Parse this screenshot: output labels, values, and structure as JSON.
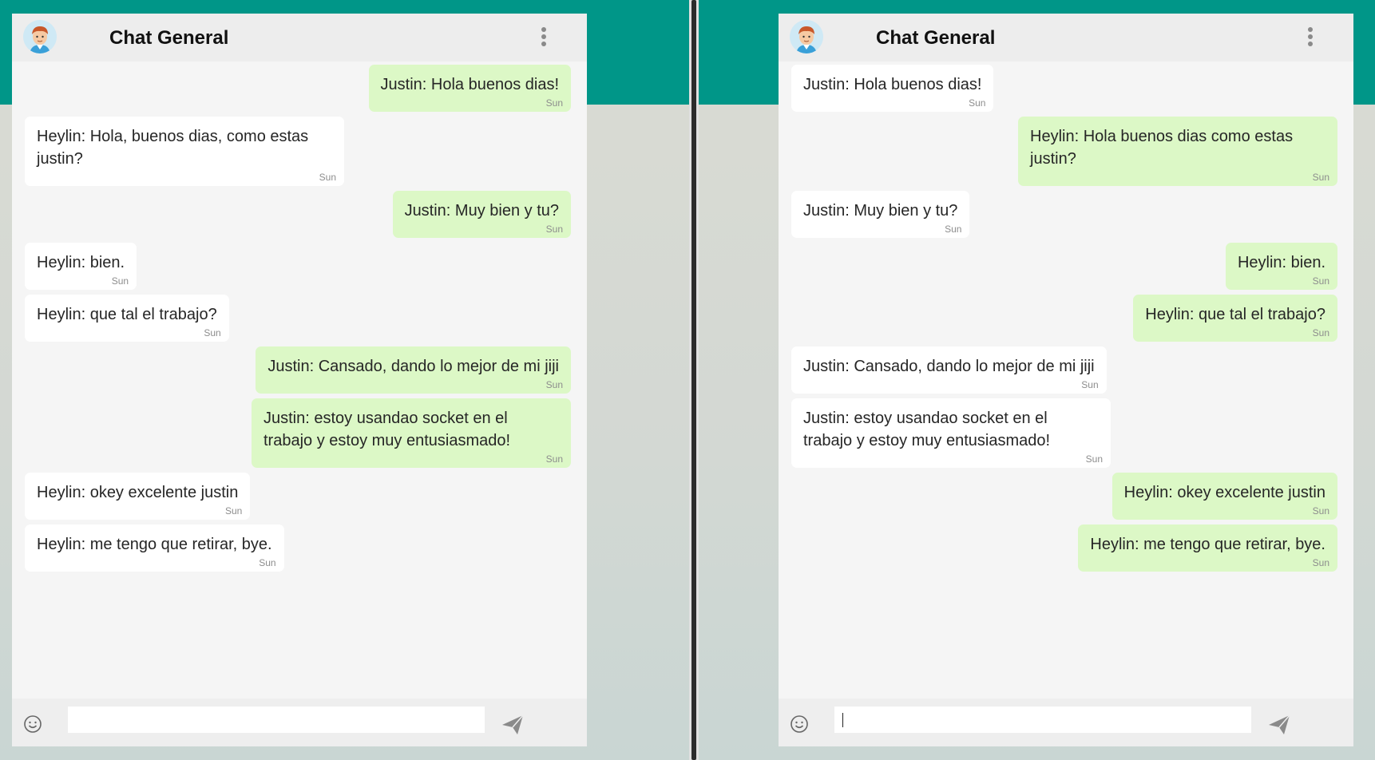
{
  "colors": {
    "teal": "#009688",
    "outgoing_bubble": "#dcf8c6",
    "incoming_bubble": "#ffffff",
    "chat_bg": "#f5f5f5"
  },
  "panels": [
    {
      "header": {
        "title": "Chat General",
        "avatar_icon": "user-avatar",
        "menu_icon": "more-vertical-icon"
      },
      "messages": [
        {
          "dir": "out",
          "text": "Justin: Hola buenos dias!",
          "time": "Sun"
        },
        {
          "dir": "in",
          "text": "Heylin: Hola, buenos dias, como estas justin?",
          "time": "Sun"
        },
        {
          "dir": "out",
          "text": "Justin: Muy bien y tu?",
          "time": "Sun"
        },
        {
          "dir": "in",
          "text": "Heylin: bien.",
          "time": "Sun"
        },
        {
          "dir": "in",
          "text": "Heylin: que tal el trabajo?",
          "time": "Sun"
        },
        {
          "dir": "out",
          "text": "Justin: Cansado, dando lo mejor de mi jiji",
          "time": "Sun"
        },
        {
          "dir": "out",
          "text": "Justin: estoy usandao socket en el trabajo y estoy muy entusiasmado!",
          "time": "Sun"
        },
        {
          "dir": "in",
          "text": "Heylin: okey excelente justin",
          "time": "Sun"
        },
        {
          "dir": "in",
          "text": "Heylin: me tengo que retirar, bye.",
          "time": "Sun"
        }
      ],
      "composer": {
        "value": "",
        "placeholder": "",
        "emoji_icon": "smiley-icon",
        "send_icon": "send-icon"
      }
    },
    {
      "header": {
        "title": "Chat General",
        "avatar_icon": "user-avatar",
        "menu_icon": "more-vertical-icon"
      },
      "messages": [
        {
          "dir": "in",
          "text": "Justin: Hola buenos dias!",
          "time": "Sun"
        },
        {
          "dir": "out",
          "text": "Heylin: Hola buenos dias como estas justin?",
          "time": "Sun"
        },
        {
          "dir": "in",
          "text": "Justin: Muy bien y tu?",
          "time": "Sun"
        },
        {
          "dir": "out",
          "text": "Heylin: bien.",
          "time": "Sun"
        },
        {
          "dir": "out",
          "text": "Heylin: que tal el trabajo?",
          "time": "Sun"
        },
        {
          "dir": "in",
          "text": "Justin: Cansado, dando lo mejor de mi jiji",
          "time": "Sun"
        },
        {
          "dir": "in",
          "text": "Justin: estoy usandao socket en el trabajo y estoy muy entusiasmado!",
          "time": "Sun"
        },
        {
          "dir": "out",
          "text": "Heylin: okey excelente justin",
          "time": "Sun"
        },
        {
          "dir": "out",
          "text": "Heylin: me tengo que retirar, bye.",
          "time": "Sun"
        }
      ],
      "composer": {
        "value": "",
        "placeholder": "",
        "emoji_icon": "smiley-icon",
        "send_icon": "send-icon"
      }
    }
  ]
}
